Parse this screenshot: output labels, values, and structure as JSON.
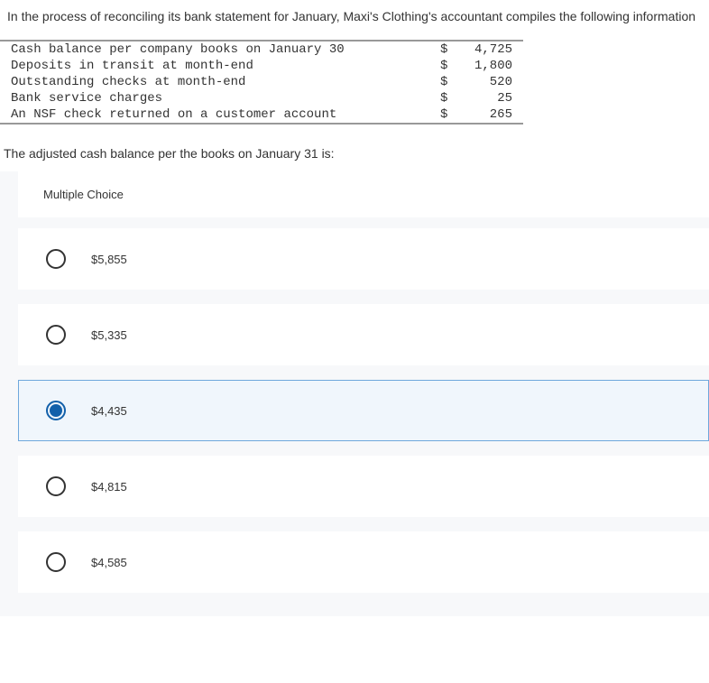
{
  "header": {
    "intro": "In the process of reconciling its bank statement for January, Maxi's Clothing's accountant compiles the following information"
  },
  "table": {
    "rows": [
      {
        "label": "Cash balance per company books on January 30",
        "dollar": "$",
        "value": "4,725"
      },
      {
        "label": "Deposits in transit at month-end",
        "dollar": "$",
        "value": "1,800"
      },
      {
        "label": "Outstanding checks at month-end",
        "dollar": "$",
        "value": "520"
      },
      {
        "label": "Bank service charges",
        "dollar": "$",
        "value": "25"
      },
      {
        "label": "An NSF check returned on a customer account",
        "dollar": "$",
        "value": "265"
      }
    ]
  },
  "prompt": "The adjusted cash balance per the books on January 31 is:",
  "mc": {
    "title": "Multiple Choice",
    "options": [
      {
        "label": "$5,855",
        "selected": false
      },
      {
        "label": "$5,335",
        "selected": false
      },
      {
        "label": "$4,435",
        "selected": true
      },
      {
        "label": "$4,815",
        "selected": false
      },
      {
        "label": "$4,585",
        "selected": false
      }
    ]
  }
}
